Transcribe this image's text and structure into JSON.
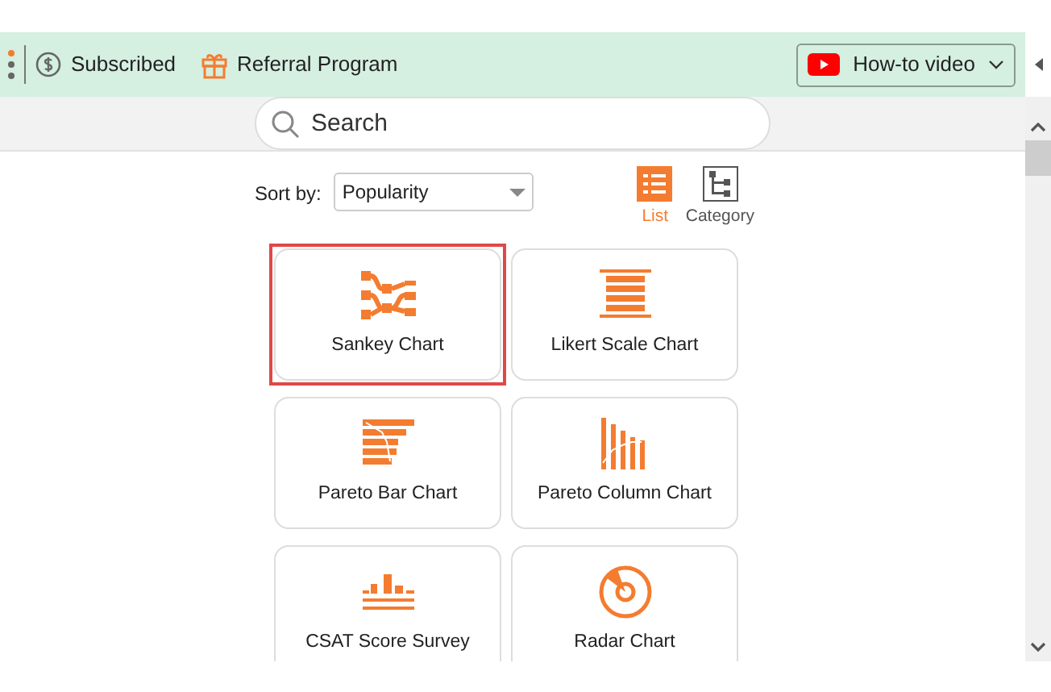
{
  "toolbar": {
    "subscription": "Subscribed",
    "referral": "Referral Program",
    "video_button": "How-to video"
  },
  "search": {
    "placeholder": "Search"
  },
  "sort": {
    "label": "Sort by:",
    "value": "Popularity"
  },
  "view_modes": [
    {
      "label": "List",
      "selected": true,
      "kind": "list"
    },
    {
      "label": "Category",
      "selected": false,
      "kind": "category"
    }
  ],
  "charts": [
    {
      "name": "Sankey Chart",
      "kind": "sankey",
      "selected": true
    },
    {
      "name": "Likert Scale Chart",
      "kind": "likert",
      "selected": false
    },
    {
      "name": "Pareto Bar Chart",
      "kind": "pareto-bar",
      "selected": false
    },
    {
      "name": "Pareto Column Chart",
      "kind": "pareto-column",
      "selected": false
    },
    {
      "name": "CSAT Score Survey",
      "kind": "csat",
      "selected": false
    },
    {
      "name": "Radar Chart",
      "kind": "radar",
      "selected": false
    }
  ]
}
